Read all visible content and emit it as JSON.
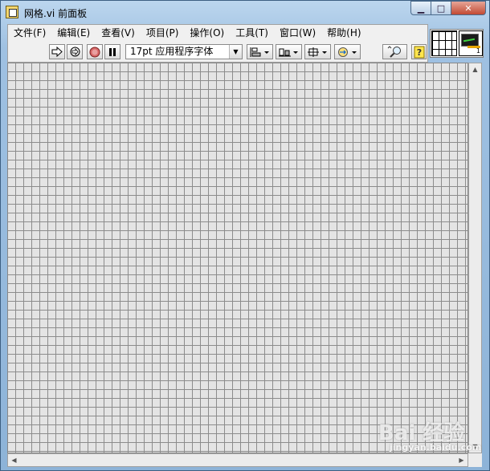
{
  "window": {
    "title": "网格.vi 前面板",
    "controls": {
      "minimize": "▁",
      "maximize": "□",
      "close": "✕"
    }
  },
  "menu": {
    "items": [
      "文件(F)",
      "编辑(E)",
      "查看(V)",
      "项目(P)",
      "操作(O)",
      "工具(T)",
      "窗口(W)",
      "帮助(H)"
    ]
  },
  "toolbar": {
    "run_icon": "run-arrow-icon",
    "font_value": "17pt 应用程序字体",
    "dropdown_glyph": "▼"
  },
  "icon_pane": {
    "connector_number": "1"
  },
  "watermark": {
    "text": "Bai 经验",
    "sub": "jingyan.baidu.com"
  }
}
